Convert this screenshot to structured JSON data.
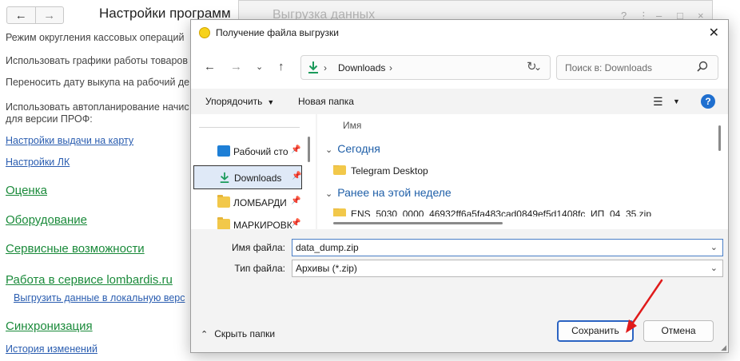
{
  "background": {
    "nav_back": "←",
    "nav_forward": "→",
    "title": "Настройки программ",
    "lines": [
      "Режим округления кассовых операций",
      "Использовать графики работы товаров",
      "Переносить дату выкупа на рабочий де",
      "Использовать автопланирование начис",
      "для версии ПРОФ:"
    ],
    "links": [
      "Настройки выдачи на карту",
      "Настройки ЛК"
    ],
    "sections": [
      "Оценка",
      "Оборудование",
      "Сервисные возможности",
      "Работа в сервисе lombardis.ru",
      "Синхронизация"
    ],
    "sublink": "Выгрузить данные в локальную верс",
    "history_link": "История изменений"
  },
  "middle_dialog": {
    "title": "Выгрузка данных",
    "help": "?",
    "more": "⋮",
    "minimize": "–",
    "maximize": "□",
    "close": "×"
  },
  "file_dialog": {
    "title": "Получение файла выгрузки",
    "close": "✕",
    "address": {
      "path_label": "Downloads",
      "search_placeholder": "Поиск в: Downloads"
    },
    "commands": {
      "organize": "Упорядочить",
      "new_folder": "Новая папка",
      "help": "?"
    },
    "nav_items": [
      {
        "label": "Рабочий сто",
        "icon": "desktop-icon",
        "pinned": true,
        "selected": false
      },
      {
        "label": "Downloads",
        "icon": "download-icon",
        "pinned": true,
        "selected": true
      },
      {
        "label": "ЛОМБАРДИ",
        "icon": "folder-icon",
        "pinned": true,
        "selected": false
      },
      {
        "label": "МАРКИРОВКИ",
        "icon": "folder-icon",
        "pinned": true,
        "selected": false
      }
    ],
    "file_list": {
      "column_name": "Имя",
      "groups": [
        {
          "label": "Сегодня",
          "files": [
            "Telegram Desktop"
          ]
        },
        {
          "label": "Ранее на этой неделе",
          "files": [
            "ENS_5030_0000_46932ff6a5fa483cad0849ef5d1408fc_ИП_04_35.zip"
          ]
        }
      ]
    },
    "fields": {
      "filename_label": "Имя файла:",
      "filename_value": "data_dump.zip",
      "filetype_label": "Тип файла:",
      "filetype_value": "Архивы (*.zip)"
    },
    "buttons": {
      "hide_folders": "Скрыть папки",
      "save": "Сохранить",
      "cancel": "Отмена"
    }
  },
  "colors": {
    "accent": "#2b63c2",
    "annotation_arrow": "#e01b1b",
    "section_green": "#1a8a3a",
    "link_blue": "#2a5db0"
  }
}
